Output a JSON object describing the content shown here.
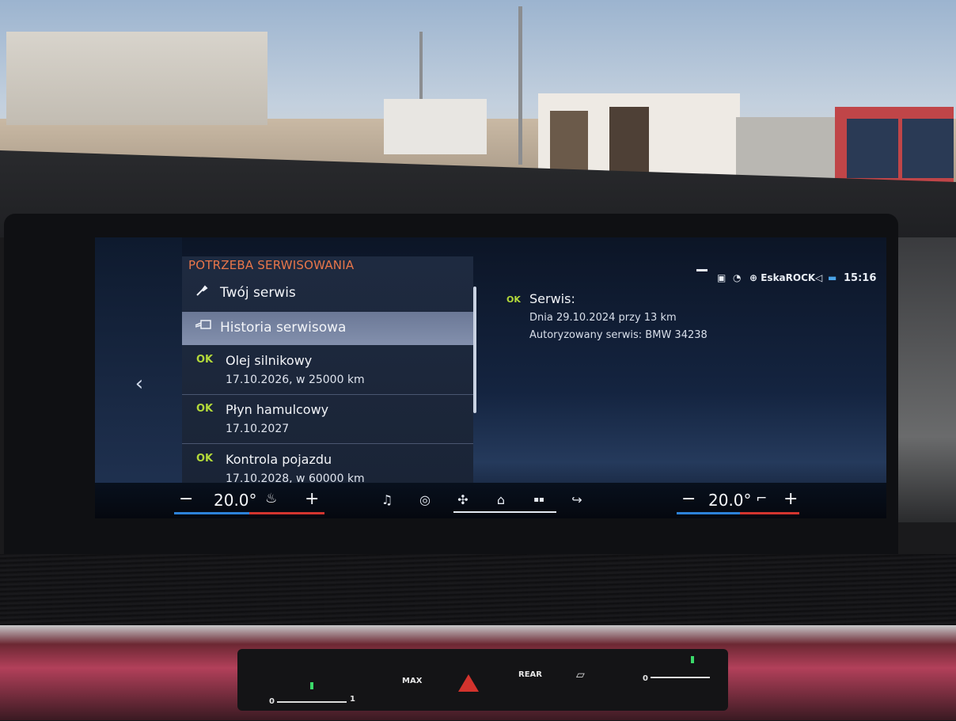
{
  "service_menu": {
    "title": "POTRZEBA SERWISOWANIA",
    "items": [
      {
        "icon": "wrench-icon",
        "glyph": "🔧",
        "label": "Twój serwis"
      },
      {
        "icon": "service-history-icon",
        "glyph": "⌂",
        "label": "Historia serwisowa",
        "selected": true
      }
    ],
    "service_items": [
      {
        "status": "OK",
        "label": "Olej silnikowy",
        "value": "17.10.2026, w 25000 km"
      },
      {
        "status": "OK",
        "label": "Płyn hamulcowy",
        "value": "17.10.2027"
      },
      {
        "status": "OK",
        "label": "Kontrola pojazdu",
        "value": "17.10.2028, w 60000 km"
      }
    ]
  },
  "detail": {
    "status": "OK",
    "title": "Serwis:",
    "line1": "Dnia 29.10.2024 przy 13 km",
    "line2": "Autoryzowany serwis: BMW 34238"
  },
  "status_bar": {
    "radio_station": "EskaROCK",
    "time": "15:16",
    "icons": [
      "minimize-icon",
      "sim-icon",
      "connectivity-icon",
      "radio-icon",
      "volume-icon",
      "weather-icon"
    ]
  },
  "climate": {
    "left": {
      "minus": "−",
      "temperature": "20.0°",
      "plus": "+"
    },
    "right": {
      "minus": "−",
      "temperature": "20.0°",
      "plus": "+"
    }
  },
  "dock": {
    "buttons": [
      "music-icon",
      "drive-icon",
      "fan-icon",
      "home-icon",
      "apps-icon",
      "phone-icon"
    ],
    "glyphs": [
      "♫",
      "◎",
      "✣",
      "⌂",
      "▪▪",
      "↪"
    ]
  },
  "physical_controls": {
    "max_label": "MAX",
    "rear_label": "REAR",
    "slider_left": {
      "min": "0",
      "max": "1"
    },
    "slider_right": {
      "min": "0"
    }
  }
}
